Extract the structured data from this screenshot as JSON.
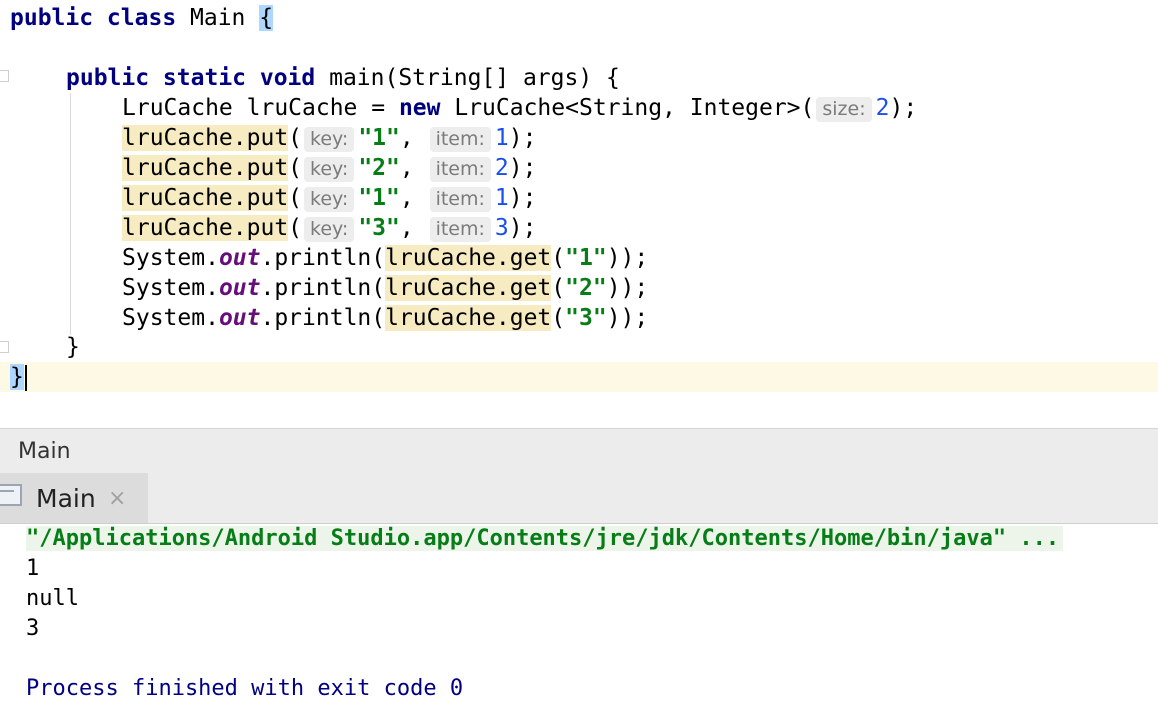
{
  "editor": {
    "line1": {
      "kw": "public class",
      "name": " Main ",
      "brace": "{"
    },
    "line2": {
      "kw": "public static void",
      "rest": " main(String[] args) {"
    },
    "line3": {
      "type": "LruCache lruCache = ",
      "kw": "new",
      "rest": " LruCache<String, Integer>(",
      "hint": "size:",
      "num": "2",
      "end": ");"
    },
    "puts": [
      {
        "call": "lruCache.put",
        "open": "(",
        "key_hint": "key:",
        "key": "\"1\"",
        "sep": ",",
        "item_hint": "item:",
        "item": "1",
        "end": ");"
      },
      {
        "call": "lruCache.put",
        "open": "(",
        "key_hint": "key:",
        "key": "\"2\"",
        "sep": ",",
        "item_hint": "item:",
        "item": "2",
        "end": ");"
      },
      {
        "call": "lruCache.put",
        "open": "(",
        "key_hint": "key:",
        "key": "\"1\"",
        "sep": ",",
        "item_hint": "item:",
        "item": "1",
        "end": ");"
      },
      {
        "call": "lruCache.put",
        "open": "(",
        "key_hint": "key:",
        "key": "\"3\"",
        "sep": ",",
        "item_hint": "item:",
        "item": "3",
        "end": ");"
      }
    ],
    "prints": [
      {
        "prefix": "System.",
        "field": "out",
        "mid": ".println(",
        "call": "lruCache.get",
        "open": "(",
        "arg": "\"1\"",
        "end": "));"
      },
      {
        "prefix": "System.",
        "field": "out",
        "mid": ".println(",
        "call": "lruCache.get",
        "open": "(",
        "arg": "\"2\"",
        "end": "));"
      },
      {
        "prefix": "System.",
        "field": "out",
        "mid": ".println(",
        "call": "lruCache.get",
        "open": "(",
        "arg": "\"3\"",
        "end": "));"
      }
    ],
    "close_method": "}",
    "close_class": "}"
  },
  "run_panel": {
    "title": "Main",
    "tab_label": "Main",
    "tab_close": "×"
  },
  "console": {
    "command": "\"/Applications/Android Studio.app/Contents/jre/jdk/Contents/Home/bin/java\" ...",
    "outputs": [
      "1",
      "null",
      "3"
    ],
    "exit_message": "Process finished with exit code 0"
  }
}
